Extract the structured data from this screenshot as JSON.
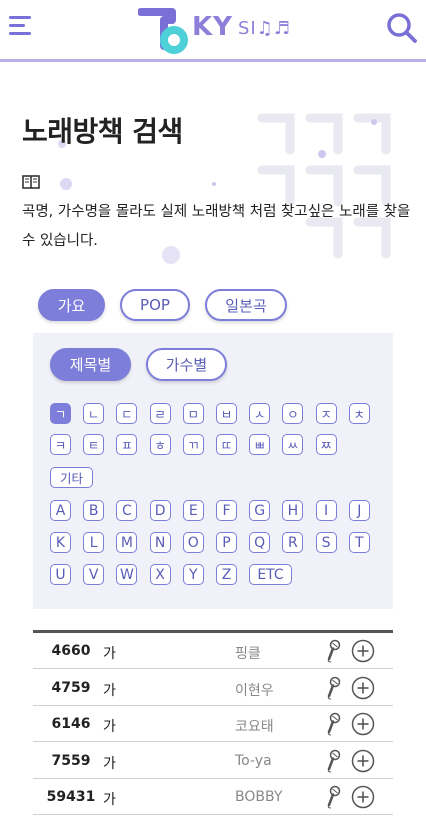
{
  "header": {
    "logo_ky": "KY",
    "logo_sing": "SI♫♬"
  },
  "intro": {
    "title": "노래방책 검색",
    "description": "곡명, 가수명을 몰라도 실제 노래방책 처럼 찾고싶은 노래를 찾을수 있습니다."
  },
  "category_tabs": [
    {
      "label": "가요",
      "active": true
    },
    {
      "label": "POP",
      "active": false
    },
    {
      "label": "일본곡",
      "active": false
    }
  ],
  "search_by": [
    {
      "label": "제목별",
      "active": true
    },
    {
      "label": "가수별",
      "active": false
    }
  ],
  "hangul_keys": [
    "ㄱ",
    "ㄴ",
    "ㄷ",
    "ㄹ",
    "ㅁ",
    "ㅂ",
    "ㅅ",
    "ㅇ",
    "ㅈ",
    "ㅊ",
    "ㅋ",
    "ㅌ",
    "ㅍ",
    "ㅎ",
    "ㄲ",
    "ㄸ",
    "ㅃ",
    "ㅆ",
    "ㅉ",
    "기타"
  ],
  "active_key": "ㄱ",
  "latin_keys": [
    "A",
    "B",
    "C",
    "D",
    "E",
    "F",
    "G",
    "H",
    "I",
    "J",
    "K",
    "L",
    "M",
    "N",
    "O",
    "P",
    "Q",
    "R",
    "S",
    "T",
    "U",
    "V",
    "W",
    "X",
    "Y",
    "Z",
    "ETC"
  ],
  "songs": [
    {
      "number": "4660",
      "title": "가",
      "artist": "핑클"
    },
    {
      "number": "4759",
      "title": "가",
      "artist": "이현우"
    },
    {
      "number": "6146",
      "title": "가",
      "artist": "코요태"
    },
    {
      "number": "7559",
      "title": "가",
      "artist": "To-ya"
    },
    {
      "number": "59431",
      "title": "가",
      "artist": "BOBBY"
    }
  ],
  "colors": {
    "accent": "#7d7ed9",
    "accent_text": "#5a5db7",
    "panel_bg": "#f1f1f9",
    "logo_cyan": "#4dd0d8"
  }
}
